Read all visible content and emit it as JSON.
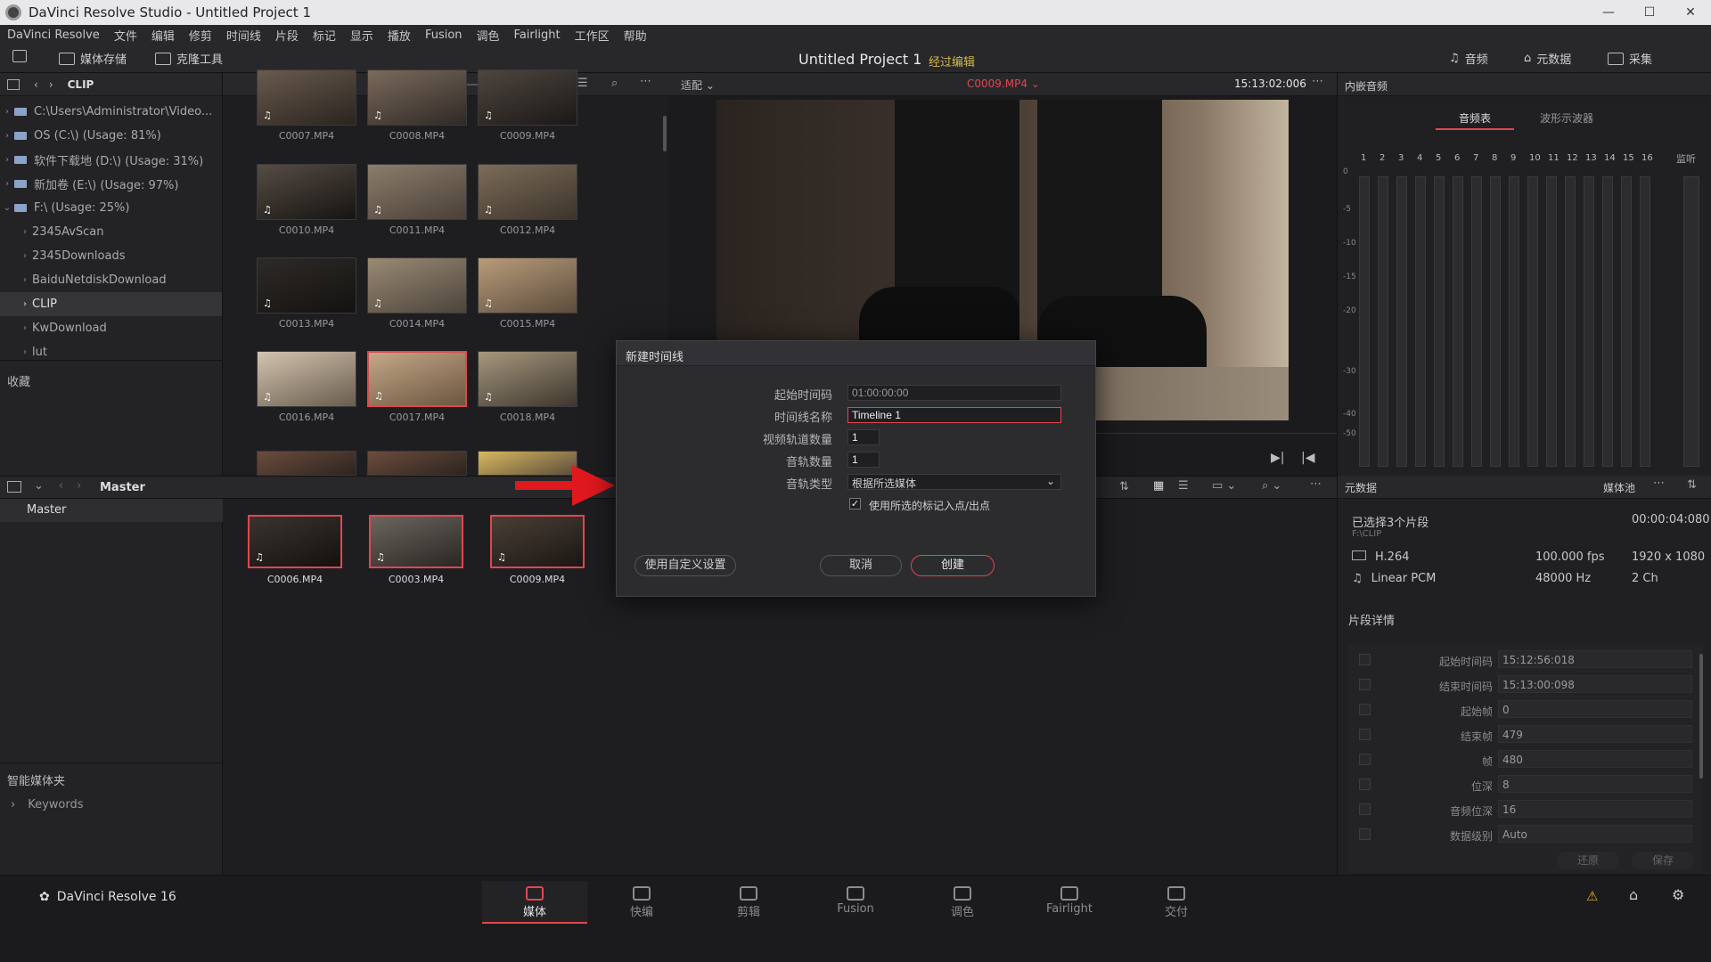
{
  "window": {
    "title": "DaVinci Resolve Studio - Untitled Project 1",
    "controls": [
      "—",
      "☐",
      "✕"
    ]
  },
  "menu": [
    "DaVinci Resolve",
    "文件",
    "编辑",
    "修剪",
    "时间线",
    "片段",
    "标记",
    "显示",
    "播放",
    "Fusion",
    "调色",
    "Fairlight",
    "工作区",
    "帮助"
  ],
  "toolbar": {
    "media_storage": "媒体存储",
    "clone_tool": "克隆工具",
    "project_title": "Untitled Project 1",
    "project_state": "经过编辑",
    "audio": "音频",
    "metadata": "元数据",
    "capture": "采集"
  },
  "media_panel": {
    "path_label": "CLIP"
  },
  "tree": [
    {
      "label": "C:\\Users\\Administrator\\Video...",
      "type": "drive"
    },
    {
      "label": "OS (C:\\) (Usage: 81%)",
      "type": "drive"
    },
    {
      "label": "软件下载地 (D:\\) (Usage: 31%)",
      "type": "drive"
    },
    {
      "label": "新加卷 (E:\\) (Usage: 97%)",
      "type": "drive"
    },
    {
      "label": "F:\\ (Usage: 25%)",
      "type": "drive"
    },
    {
      "label": "2345AvScan",
      "type": "folder"
    },
    {
      "label": "2345Downloads",
      "type": "folder"
    },
    {
      "label": "BaiduNetdiskDownload",
      "type": "folder"
    },
    {
      "label": "CLIP",
      "type": "folder"
    },
    {
      "label": "KwDownload",
      "type": "folder"
    },
    {
      "label": "lut",
      "type": "folder"
    }
  ],
  "favorites_label": "收藏",
  "clips": [
    "C0007.MP4",
    "C0008.MP4",
    "C0009.MP4",
    "C0010.MP4",
    "C0011.MP4",
    "C0012.MP4",
    "C0013.MP4",
    "C0014.MP4",
    "C0015.MP4",
    "C0016.MP4",
    "C0017.MP4",
    "C0018.MP4"
  ],
  "viewer": {
    "fit": "适配",
    "clip_name": "C0009.MP4",
    "timecode": "15:13:02:006"
  },
  "audio_panel": {
    "title": "内嵌音频",
    "tab_audio": "音频表",
    "tab_wave": "波形示波器",
    "monitor": "监听",
    "channels": [
      "1",
      "2",
      "3",
      "4",
      "5",
      "6",
      "7",
      "8",
      "9",
      "10",
      "11",
      "12",
      "13",
      "14",
      "15",
      "16"
    ],
    "scale": [
      "0",
      "-5",
      "-10",
      "-15",
      "-20",
      "-30",
      "-40",
      "-50"
    ]
  },
  "bin": {
    "name": "Master",
    "list": [
      "Master"
    ],
    "smart_bins": "智能媒体夹",
    "keywords": "Keywords",
    "clips": [
      "C0006.MP4",
      "C0003.MP4",
      "C0009.MP4"
    ]
  },
  "metadata": {
    "title": "元数据",
    "pool": "媒体池",
    "selected": "已选择3个片段",
    "duration": "00:00:04:080",
    "path": "F:\\CLIP",
    "codec": "H.264",
    "fps": "100.000 fps",
    "resolution": "1920 x 1080",
    "audio_codec": "Linear PCM",
    "sample_rate": "48000 Hz",
    "channels": "2 Ch",
    "details_title": "片段详情",
    "details": [
      {
        "label": "起始时间码",
        "value": "15:12:56:018"
      },
      {
        "label": "结束时间码",
        "value": "15:13:00:098"
      },
      {
        "label": "起始帧",
        "value": "0"
      },
      {
        "label": "结束帧",
        "value": "479"
      },
      {
        "label": "帧",
        "value": "480"
      },
      {
        "label": "位深",
        "value": "8"
      },
      {
        "label": "音频位深",
        "value": "16"
      },
      {
        "label": "数据级别",
        "value": "Auto"
      }
    ],
    "revert": "还原",
    "save": "保存"
  },
  "dialog": {
    "title": "新建时间线",
    "start_tc_label": "起始时间码",
    "start_tc": "01:00:00:00",
    "name_label": "时间线名称",
    "name": "Timeline 1",
    "video_tracks_label": "视频轨道数量",
    "video_tracks": "1",
    "audio_tracks_label": "音轨数量",
    "audio_tracks": "1",
    "audio_type_label": "音轨类型",
    "audio_type": "根据所选媒体",
    "use_marks": "使用所选的标记入点/出点",
    "custom": "使用自定义设置",
    "cancel": "取消",
    "create": "创建"
  },
  "pages": {
    "brand": "DaVinci Resolve 16",
    "items": [
      "媒体",
      "快编",
      "剪辑",
      "Fusion",
      "调色",
      "Fairlight",
      "交付"
    ]
  },
  "colors": {
    "accent": "#e0474f",
    "state": "#d4b74d"
  }
}
